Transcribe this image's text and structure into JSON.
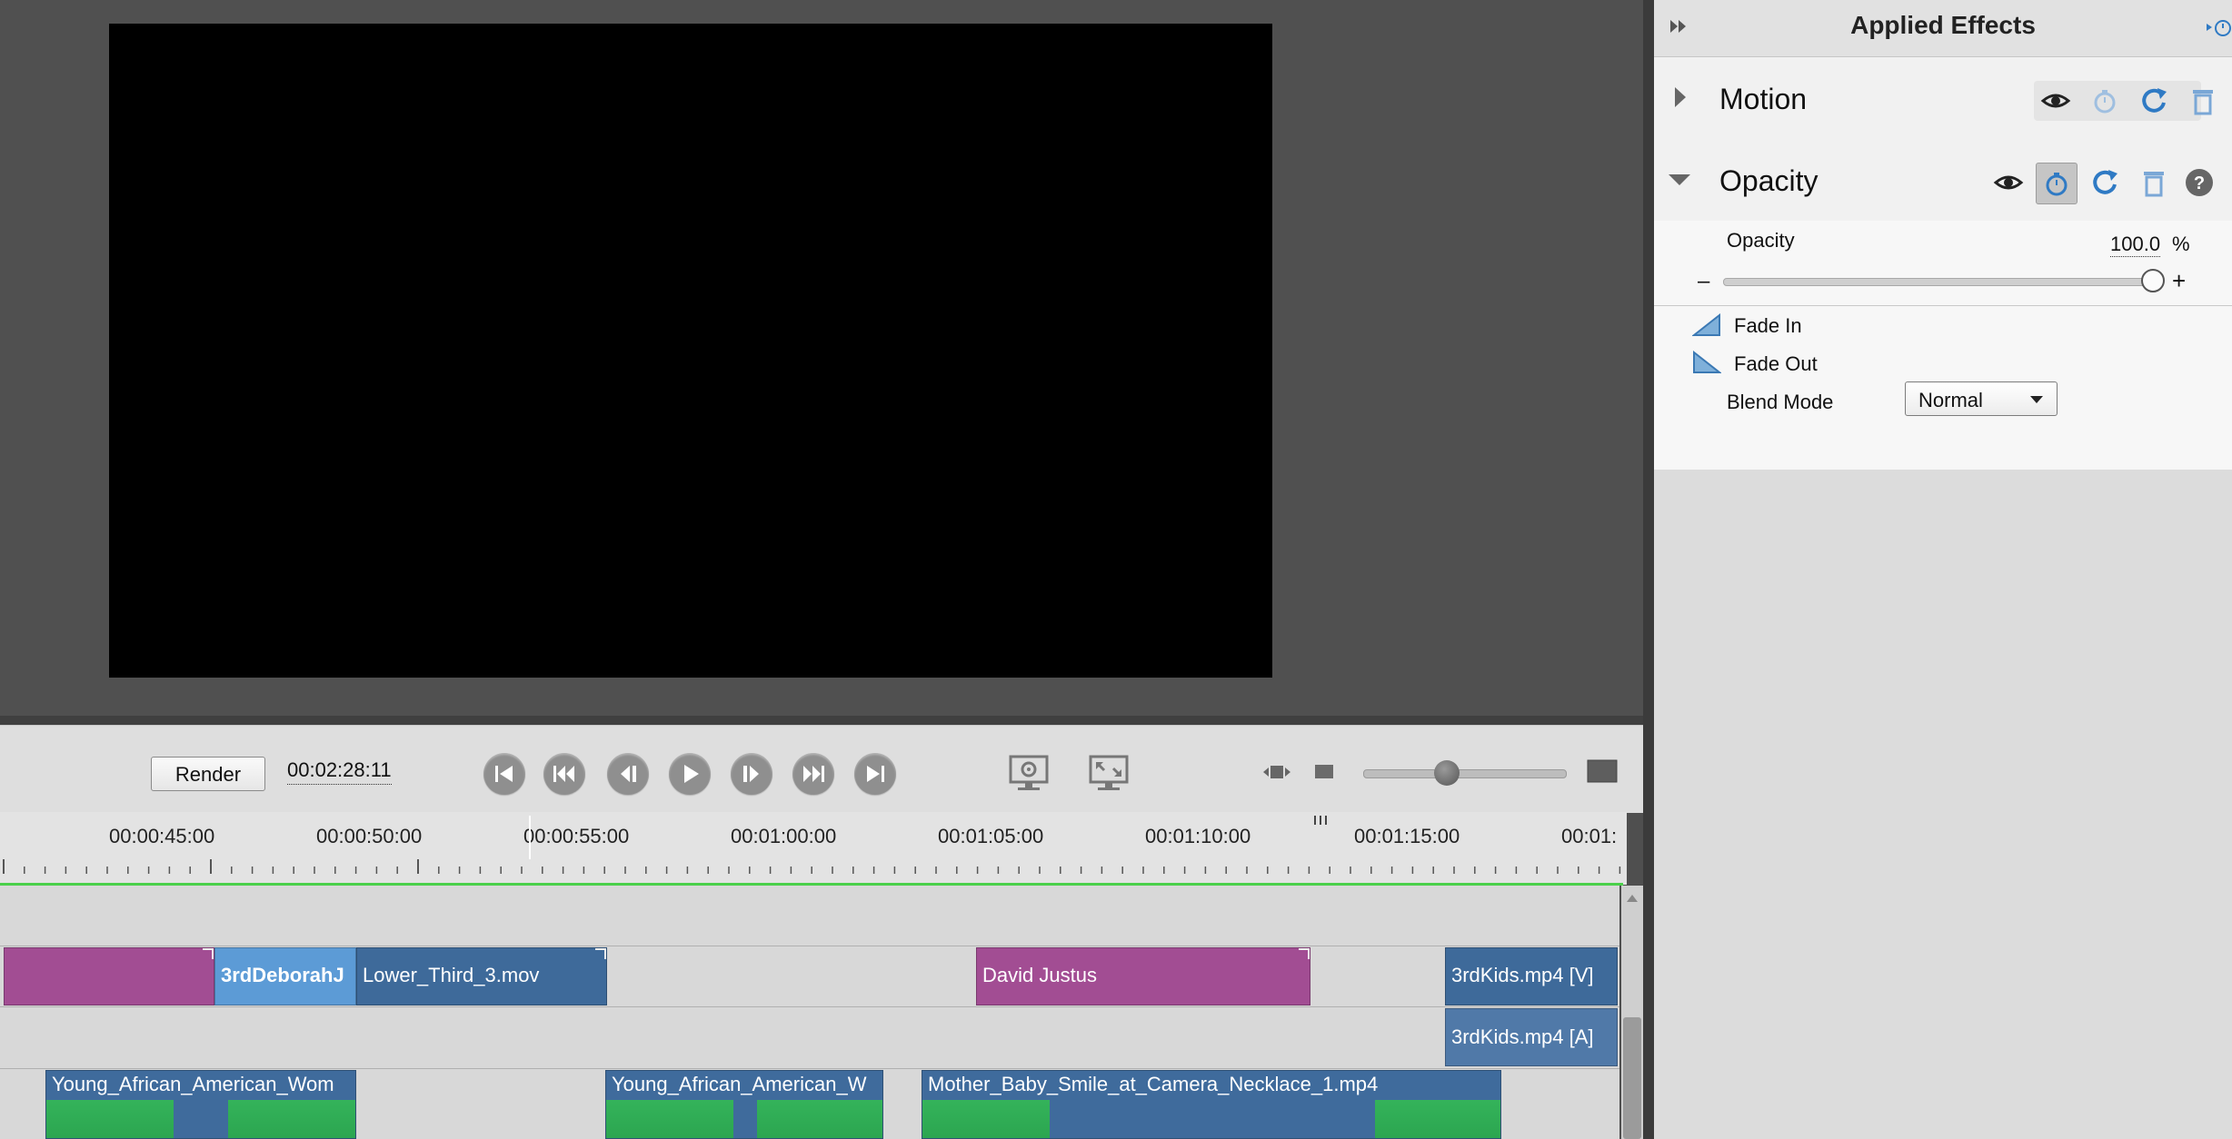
{
  "monitor": {
    "render_label": "Render",
    "timecode": "00:02:28:11"
  },
  "transport": {
    "buttons": [
      "go-to-start",
      "previous-edit",
      "step-back",
      "play",
      "step-forward",
      "next-edit",
      "go-to-end"
    ]
  },
  "timeline": {
    "ruler_labels": [
      "00:00:45:00",
      "00:00:50:00",
      "00:00:55:00",
      "00:01:00:00",
      "00:01:05:00",
      "00:01:10:00",
      "00:01:15:00",
      "00:01:"
    ],
    "title_track": [
      {
        "label": "",
        "color": "purple"
      },
      {
        "label": "3rdDeborahJ",
        "color": "lightblue"
      },
      {
        "label": "Lower_Third_3.mov",
        "color": "blue"
      },
      {
        "label": "David Justus",
        "color": "purple"
      },
      {
        "label": "3rdKids.mp4 [V]",
        "color": "blue"
      }
    ],
    "audio_track": [
      {
        "label": "3rdKids.mp4 [A]"
      }
    ],
    "video_track": [
      {
        "label": "Young_African_American_Wom"
      },
      {
        "label": "Young_African_American_W"
      },
      {
        "label": "Mother_Baby_Smile_at_Camera_Necklace_1.mp4"
      }
    ]
  },
  "effects": {
    "title": "Applied Effects",
    "motion": {
      "title": "Motion"
    },
    "opacity": {
      "title": "Opacity",
      "property_label": "Opacity",
      "value": "100.0",
      "unit": "%",
      "slider_minus": "–",
      "slider_plus": "+",
      "fade_in": "Fade In",
      "fade_out": "Fade Out",
      "blend_label": "Blend Mode",
      "blend_value": "Normal"
    }
  },
  "colors": {
    "clip_purple": "#a24d93",
    "clip_blue": "#3e6a9a",
    "clip_lightblue": "#5c9bd6",
    "ruler_line": "#4ad04a",
    "accent_blue": "#2f7ac4"
  }
}
